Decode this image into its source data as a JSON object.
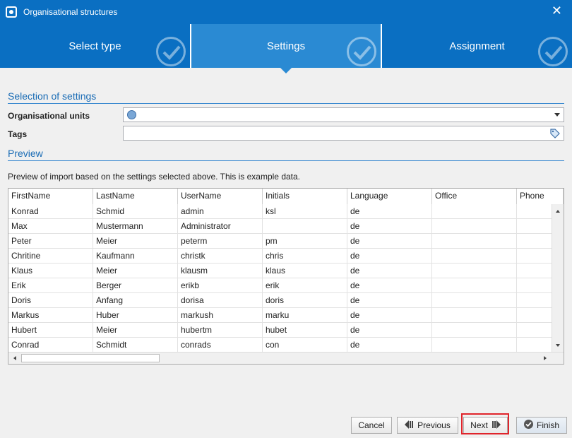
{
  "window": {
    "title": "Organisational structures"
  },
  "tabs": [
    {
      "label": "Select type",
      "active": false
    },
    {
      "label": "Settings",
      "active": true
    },
    {
      "label": "Assignment",
      "active": false
    }
  ],
  "settings": {
    "section_title": "Selection of settings",
    "org_units_label": "Organisational units",
    "org_units_value": "",
    "tags_label": "Tags",
    "tags_value": ""
  },
  "preview": {
    "section_title": "Preview",
    "description": "Preview of import based on the settings selected above. This is example data.",
    "columns": [
      "FirstName",
      "LastName",
      "UserName",
      "Initials",
      "Language",
      "Office",
      "Phone"
    ],
    "rows": [
      [
        "Konrad",
        "Schmid",
        "admin",
        "ksl",
        "de",
        "",
        ""
      ],
      [
        "Max",
        "Mustermann",
        "Administrator",
        "",
        "de",
        "",
        ""
      ],
      [
        "Peter",
        "Meier",
        "peterm",
        "pm",
        "de",
        "",
        ""
      ],
      [
        "Chritine",
        "Kaufmann",
        "christk",
        "chris",
        "de",
        "",
        ""
      ],
      [
        "Klaus",
        "Meier",
        "klausm",
        "klaus",
        "de",
        "",
        ""
      ],
      [
        "Erik",
        "Berger",
        "erikb",
        "erik",
        "de",
        "",
        ""
      ],
      [
        "Doris",
        "Anfang",
        "dorisa",
        "doris",
        "de",
        "",
        ""
      ],
      [
        "Markus",
        "Huber",
        "markush",
        "marku",
        "de",
        "",
        ""
      ],
      [
        "Hubert",
        "Meier",
        "hubertm",
        "hubet",
        "de",
        "",
        ""
      ],
      [
        "Conrad",
        "Schmidt",
        "conrads",
        "con",
        "de",
        "",
        ""
      ]
    ]
  },
  "footer": {
    "cancel": "Cancel",
    "previous": "Previous",
    "next": "Next",
    "finish": "Finish"
  },
  "colors": {
    "accent": "#0a6fc2",
    "active_tab": "#2a8ad3",
    "highlight": "#e0242b"
  },
  "icons": {
    "app": "app-icon",
    "close": "close-icon",
    "check": "check-icon",
    "globe": "globe-icon",
    "tag": "tag-icon",
    "previous": "arrow-left-icon",
    "next": "arrow-right-icon",
    "finish": "check-circle-icon"
  }
}
